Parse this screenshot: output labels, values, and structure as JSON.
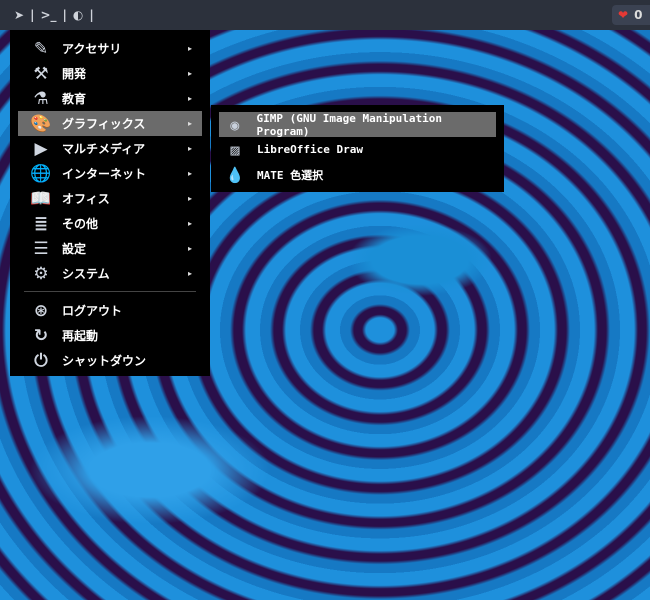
{
  "topbar": {
    "launcher_icon": "paper-plane-icon",
    "sep1": "|",
    "terminal_icon": "terminal-icon",
    "sep2": "|",
    "theme_icon": "moon-icon",
    "sep3": "|",
    "badge_icon": "heart-icon",
    "badge_count": "0"
  },
  "menu": {
    "items": [
      {
        "label": "アクセサリ",
        "icon": "pen-icon"
      },
      {
        "label": "開発",
        "icon": "hammer-icon"
      },
      {
        "label": "教育",
        "icon": "flask-icon"
      },
      {
        "label": "グラフィックス",
        "icon": "palette-icon"
      },
      {
        "label": "マルチメディア",
        "icon": "play-icon"
      },
      {
        "label": "インターネット",
        "icon": "globe-icon"
      },
      {
        "label": "オフィス",
        "icon": "book-icon"
      },
      {
        "label": "その他",
        "icon": "list-icon"
      },
      {
        "label": "設定",
        "icon": "settings-icon"
      },
      {
        "label": "システム",
        "icon": "gear-icon"
      }
    ],
    "actions": [
      {
        "label": "ログアウト",
        "icon": "logout-icon"
      },
      {
        "label": "再起動",
        "icon": "restart-icon"
      },
      {
        "label": "シャットダウン",
        "icon": "power-icon"
      }
    ],
    "arrow": "▸"
  },
  "submenu": {
    "items": [
      {
        "label": "GIMP (GNU Image Manipulation Program)",
        "icon": "gimp-icon"
      },
      {
        "label": "LibreOffice Draw",
        "icon": "draw-icon"
      },
      {
        "label": "MATE 色選択",
        "icon": "droplet-icon"
      }
    ]
  }
}
